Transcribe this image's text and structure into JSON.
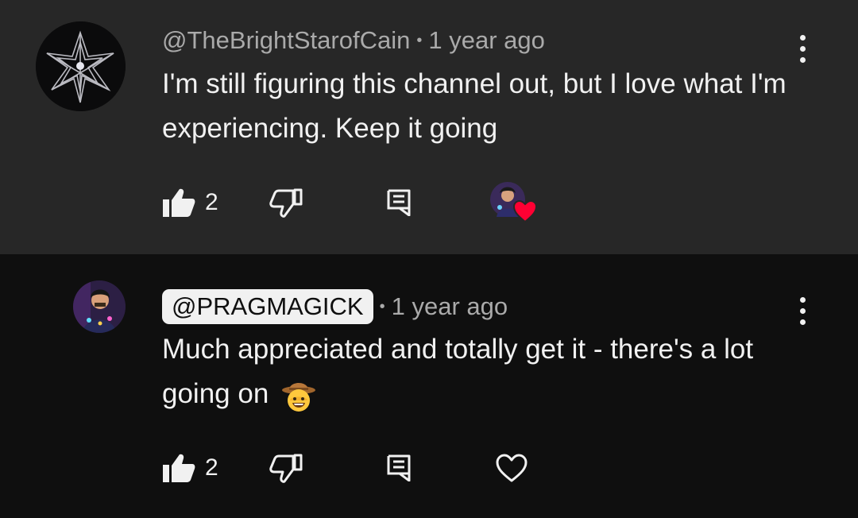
{
  "comments": [
    {
      "handle": "@TheBrightStarofCain",
      "time": "1 year ago",
      "text": "I'm still figuring this channel out, but I love what I'm experiencing.  Keep it going",
      "likes": "2",
      "creator_hearted": true
    },
    {
      "handle": "@PRAGMAGICK",
      "time": "1 year ago",
      "text": "Much appreciated and totally get it - there's a lot going on",
      "emoji": "cowboy-hat-face",
      "likes": "2",
      "creator_hearted": false
    }
  ],
  "icons": {
    "like": "thumbs-up-icon",
    "dislike": "thumbs-down-icon",
    "reply": "reply-icon",
    "heart": "heart-icon",
    "more": "more-vertical-icon"
  },
  "colors": {
    "first_comment_bg": "#272727",
    "reply_bg": "#0f0f0f",
    "heart_red": "#ff0033"
  }
}
